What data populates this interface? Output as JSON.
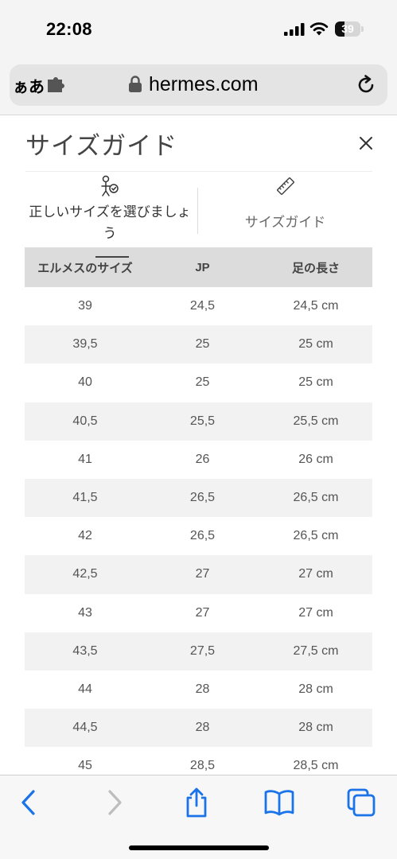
{
  "status_bar": {
    "time": "22:08",
    "battery_level": "39"
  },
  "browser": {
    "aa_label": "ぁあ",
    "url": "hermes.com"
  },
  "modal": {
    "title": "サイズガイド",
    "tabs": [
      {
        "label": "正しいサイズを選びましょう",
        "icon": "person-check-icon"
      },
      {
        "label": "サイズガイド",
        "icon": "ruler-icon"
      }
    ],
    "table": {
      "headers": [
        "エルメスのサイズ",
        "JP",
        "足の長さ"
      ],
      "rows": [
        [
          "39",
          "24,5",
          "24,5 cm"
        ],
        [
          "39,5",
          "25",
          "25 cm"
        ],
        [
          "40",
          "25",
          "25 cm"
        ],
        [
          "40,5",
          "25,5",
          "25,5 cm"
        ],
        [
          "41",
          "26",
          "26 cm"
        ],
        [
          "41,5",
          "26,5",
          "26,5 cm"
        ],
        [
          "42",
          "26,5",
          "26,5 cm"
        ],
        [
          "42,5",
          "27",
          "27 cm"
        ],
        [
          "43",
          "27",
          "27 cm"
        ],
        [
          "43,5",
          "27,5",
          "27,5 cm"
        ],
        [
          "44",
          "28",
          "28 cm"
        ],
        [
          "44,5",
          "28",
          "28 cm"
        ],
        [
          "45",
          "28,5",
          "28,5 cm"
        ]
      ]
    }
  },
  "toolbar": {
    "items": [
      "back-icon",
      "forward-icon",
      "share-icon",
      "bookmarks-icon",
      "tabs-icon"
    ]
  },
  "colors": {
    "accent": "#1a73e8",
    "header_bg": "#dcdcdc",
    "stripe_bg": "#f2f2f2"
  }
}
